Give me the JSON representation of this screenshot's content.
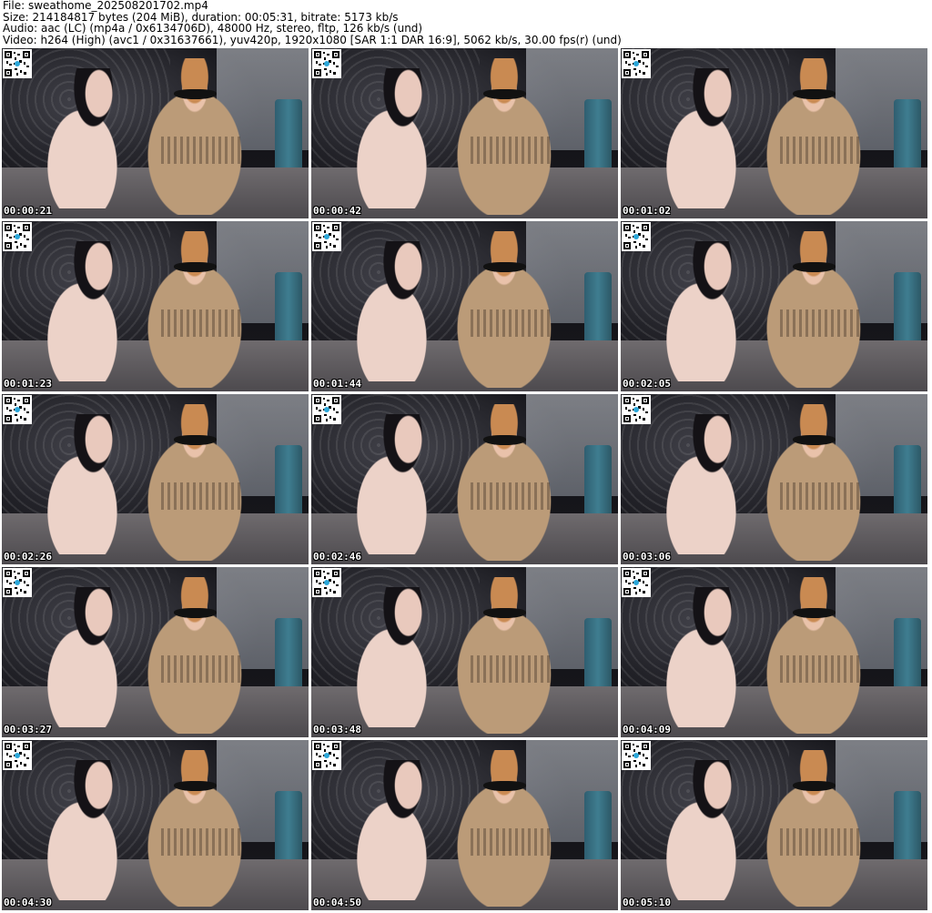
{
  "header": {
    "file": "File: sweathome_202508201702.mp4",
    "size": "Size: 214184817 bytes (204 MiB), duration: 00:05:31, bitrate: 5173 kb/s",
    "audio": "Audio: aac (LC) (mp4a / 0x6134706D), 48000 Hz, stereo, fltp, 126 kb/s (und)",
    "video": "Video: h264 (High) (avc1 / 0x31637661), yuv420p, 1920x1080 [SAR 1:1 DAR 16:9], 5062 kb/s, 30.00 fps(r) (und)"
  },
  "thumbnails": [
    {
      "timestamp": "00:00:21"
    },
    {
      "timestamp": "00:00:42"
    },
    {
      "timestamp": "00:01:02"
    },
    {
      "timestamp": "00:01:23"
    },
    {
      "timestamp": "00:01:44"
    },
    {
      "timestamp": "00:02:05"
    },
    {
      "timestamp": "00:02:26"
    },
    {
      "timestamp": "00:02:46"
    },
    {
      "timestamp": "00:03:06"
    },
    {
      "timestamp": "00:03:27"
    },
    {
      "timestamp": "00:03:48"
    },
    {
      "timestamp": "00:04:09"
    },
    {
      "timestamp": "00:04:30"
    },
    {
      "timestamp": "00:04:50"
    },
    {
      "timestamp": "00:05:10"
    }
  ]
}
